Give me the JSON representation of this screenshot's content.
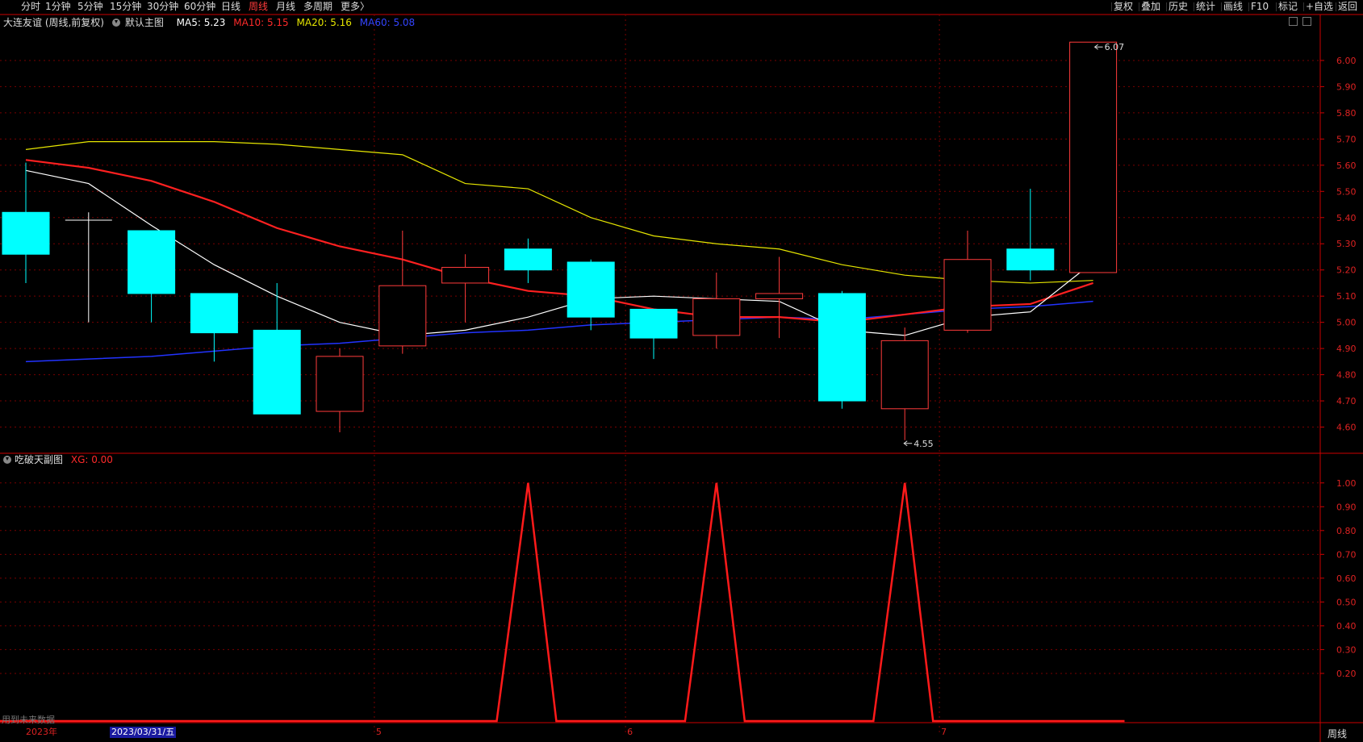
{
  "toolbar": {
    "left": [
      "分时",
      "1分钟",
      "5分钟",
      "15分钟",
      "30分钟",
      "60分钟",
      "日线",
      "周线",
      "月线",
      "多周期",
      "更多〉"
    ],
    "active": "周线",
    "right": [
      "复权",
      "叠加",
      "历史",
      "统计",
      "画线",
      "F10",
      "标记",
      "+自选",
      "返回"
    ]
  },
  "main_legend": {
    "stock": "大连友谊 (周线,前复权)",
    "template": "默认主图",
    "ma5": "MA5: 5.23",
    "ma10": "MA10: 5.15",
    "ma20": "MA20: 5.16",
    "ma60": "MA60: 5.08"
  },
  "sub_legend": {
    "name": "吃破天副图",
    "xg": "XG: 0.00"
  },
  "colors": {
    "up": "#ff3b3b",
    "down": "#00ffff",
    "ma5": "#ffffff",
    "ma10": "#ff2020",
    "ma20": "#e6e600",
    "ma60": "#2233ff",
    "grid": "#7a0000",
    "axis": "#cc0000"
  },
  "chart_data": [
    {
      "type": "candlestick",
      "ylim": [
        4.5,
        6.12
      ],
      "yticks": [
        "6.00",
        "5.90",
        "5.80",
        "5.70",
        "5.60",
        "5.50",
        "5.40",
        "5.30",
        "5.20",
        "5.10",
        "5.00",
        "4.90",
        "4.80",
        "4.70",
        "4.60"
      ],
      "candles": [
        {
          "o": 5.42,
          "h": 5.61,
          "l": 5.15,
          "c": 5.26
        },
        {
          "o": 5.39,
          "h": 5.42,
          "l": 5.0,
          "c": 5.39
        },
        {
          "o": 5.35,
          "h": 5.35,
          "l": 5.0,
          "c": 5.11
        },
        {
          "o": 5.11,
          "h": 5.11,
          "l": 4.85,
          "c": 4.96
        },
        {
          "o": 4.97,
          "h": 5.15,
          "l": 4.65,
          "c": 4.65
        },
        {
          "o": 4.66,
          "h": 4.9,
          "l": 4.58,
          "c": 4.87
        },
        {
          "o": 4.91,
          "h": 5.35,
          "l": 4.88,
          "c": 5.14
        },
        {
          "o": 5.15,
          "h": 5.26,
          "l": 5.0,
          "c": 5.21
        },
        {
          "o": 5.28,
          "h": 5.32,
          "l": 5.15,
          "c": 5.2
        },
        {
          "o": 5.23,
          "h": 5.24,
          "l": 4.97,
          "c": 5.02
        },
        {
          "o": 5.05,
          "h": 5.05,
          "l": 4.86,
          "c": 4.94
        },
        {
          "o": 4.95,
          "h": 5.19,
          "l": 4.9,
          "c": 5.09
        },
        {
          "o": 5.09,
          "h": 5.25,
          "l": 4.94,
          "c": 5.11
        },
        {
          "o": 5.11,
          "h": 5.12,
          "l": 4.67,
          "c": 4.7
        },
        {
          "o": 4.67,
          "h": 4.98,
          "l": 4.55,
          "c": 4.93
        },
        {
          "o": 4.97,
          "h": 5.35,
          "l": 4.96,
          "c": 5.24
        },
        {
          "o": 5.28,
          "h": 5.51,
          "l": 5.16,
          "c": 5.2
        },
        {
          "o": 5.19,
          "h": 6.07,
          "l": 5.19,
          "c": 6.07
        }
      ],
      "ma5": [
        5.58,
        5.53,
        5.37,
        5.22,
        5.1,
        5.0,
        4.95,
        4.97,
        5.02,
        5.09,
        5.1,
        5.09,
        5.08,
        4.97,
        4.95,
        5.02,
        5.04,
        5.23
      ],
      "ma10": [
        5.62,
        5.59,
        5.54,
        5.46,
        5.36,
        5.29,
        5.24,
        5.17,
        5.12,
        5.1,
        5.05,
        5.02,
        5.02,
        5.0,
        5.03,
        5.06,
        5.07,
        5.15
      ],
      "ma20": [
        5.66,
        5.69,
        5.69,
        5.69,
        5.68,
        5.66,
        5.64,
        5.53,
        5.51,
        5.4,
        5.33,
        5.3,
        5.28,
        5.22,
        5.18,
        5.16,
        5.15,
        5.16
      ],
      "ma60": [
        4.85,
        4.86,
        4.87,
        4.89,
        4.91,
        4.92,
        4.94,
        4.96,
        4.97,
        4.99,
        5.0,
        5.01,
        5.02,
        5.01,
        5.03,
        5.05,
        5.06,
        5.08
      ],
      "annotations": [
        {
          "index": 17,
          "value": 6.07,
          "label": "6.07"
        },
        {
          "index": 14,
          "value": 4.55,
          "label": "4.55"
        }
      ]
    },
    {
      "type": "line",
      "series": [
        {
          "name": "XG",
          "values": [
            0,
            0,
            0,
            0,
            0,
            0,
            0,
            0,
            1,
            0,
            0,
            1,
            0,
            0,
            1,
            0,
            0,
            0
          ]
        }
      ],
      "ylim": [
        0,
        1.05
      ],
      "yticks": [
        "1.00",
        "0.90",
        "0.80",
        "0.70",
        "0.60",
        "0.50",
        "0.40",
        "0.30",
        "0.20"
      ]
    }
  ],
  "x_axis": {
    "labels": [
      {
        "text": "2023年",
        "index": 0
      },
      {
        "text": "5",
        "index": 6
      },
      {
        "text": "6",
        "index": 10
      },
      {
        "text": "7",
        "index": 15
      }
    ],
    "cursor_date": "2023/03/31/五",
    "period": "周线"
  },
  "footnote": "用到未来数据"
}
